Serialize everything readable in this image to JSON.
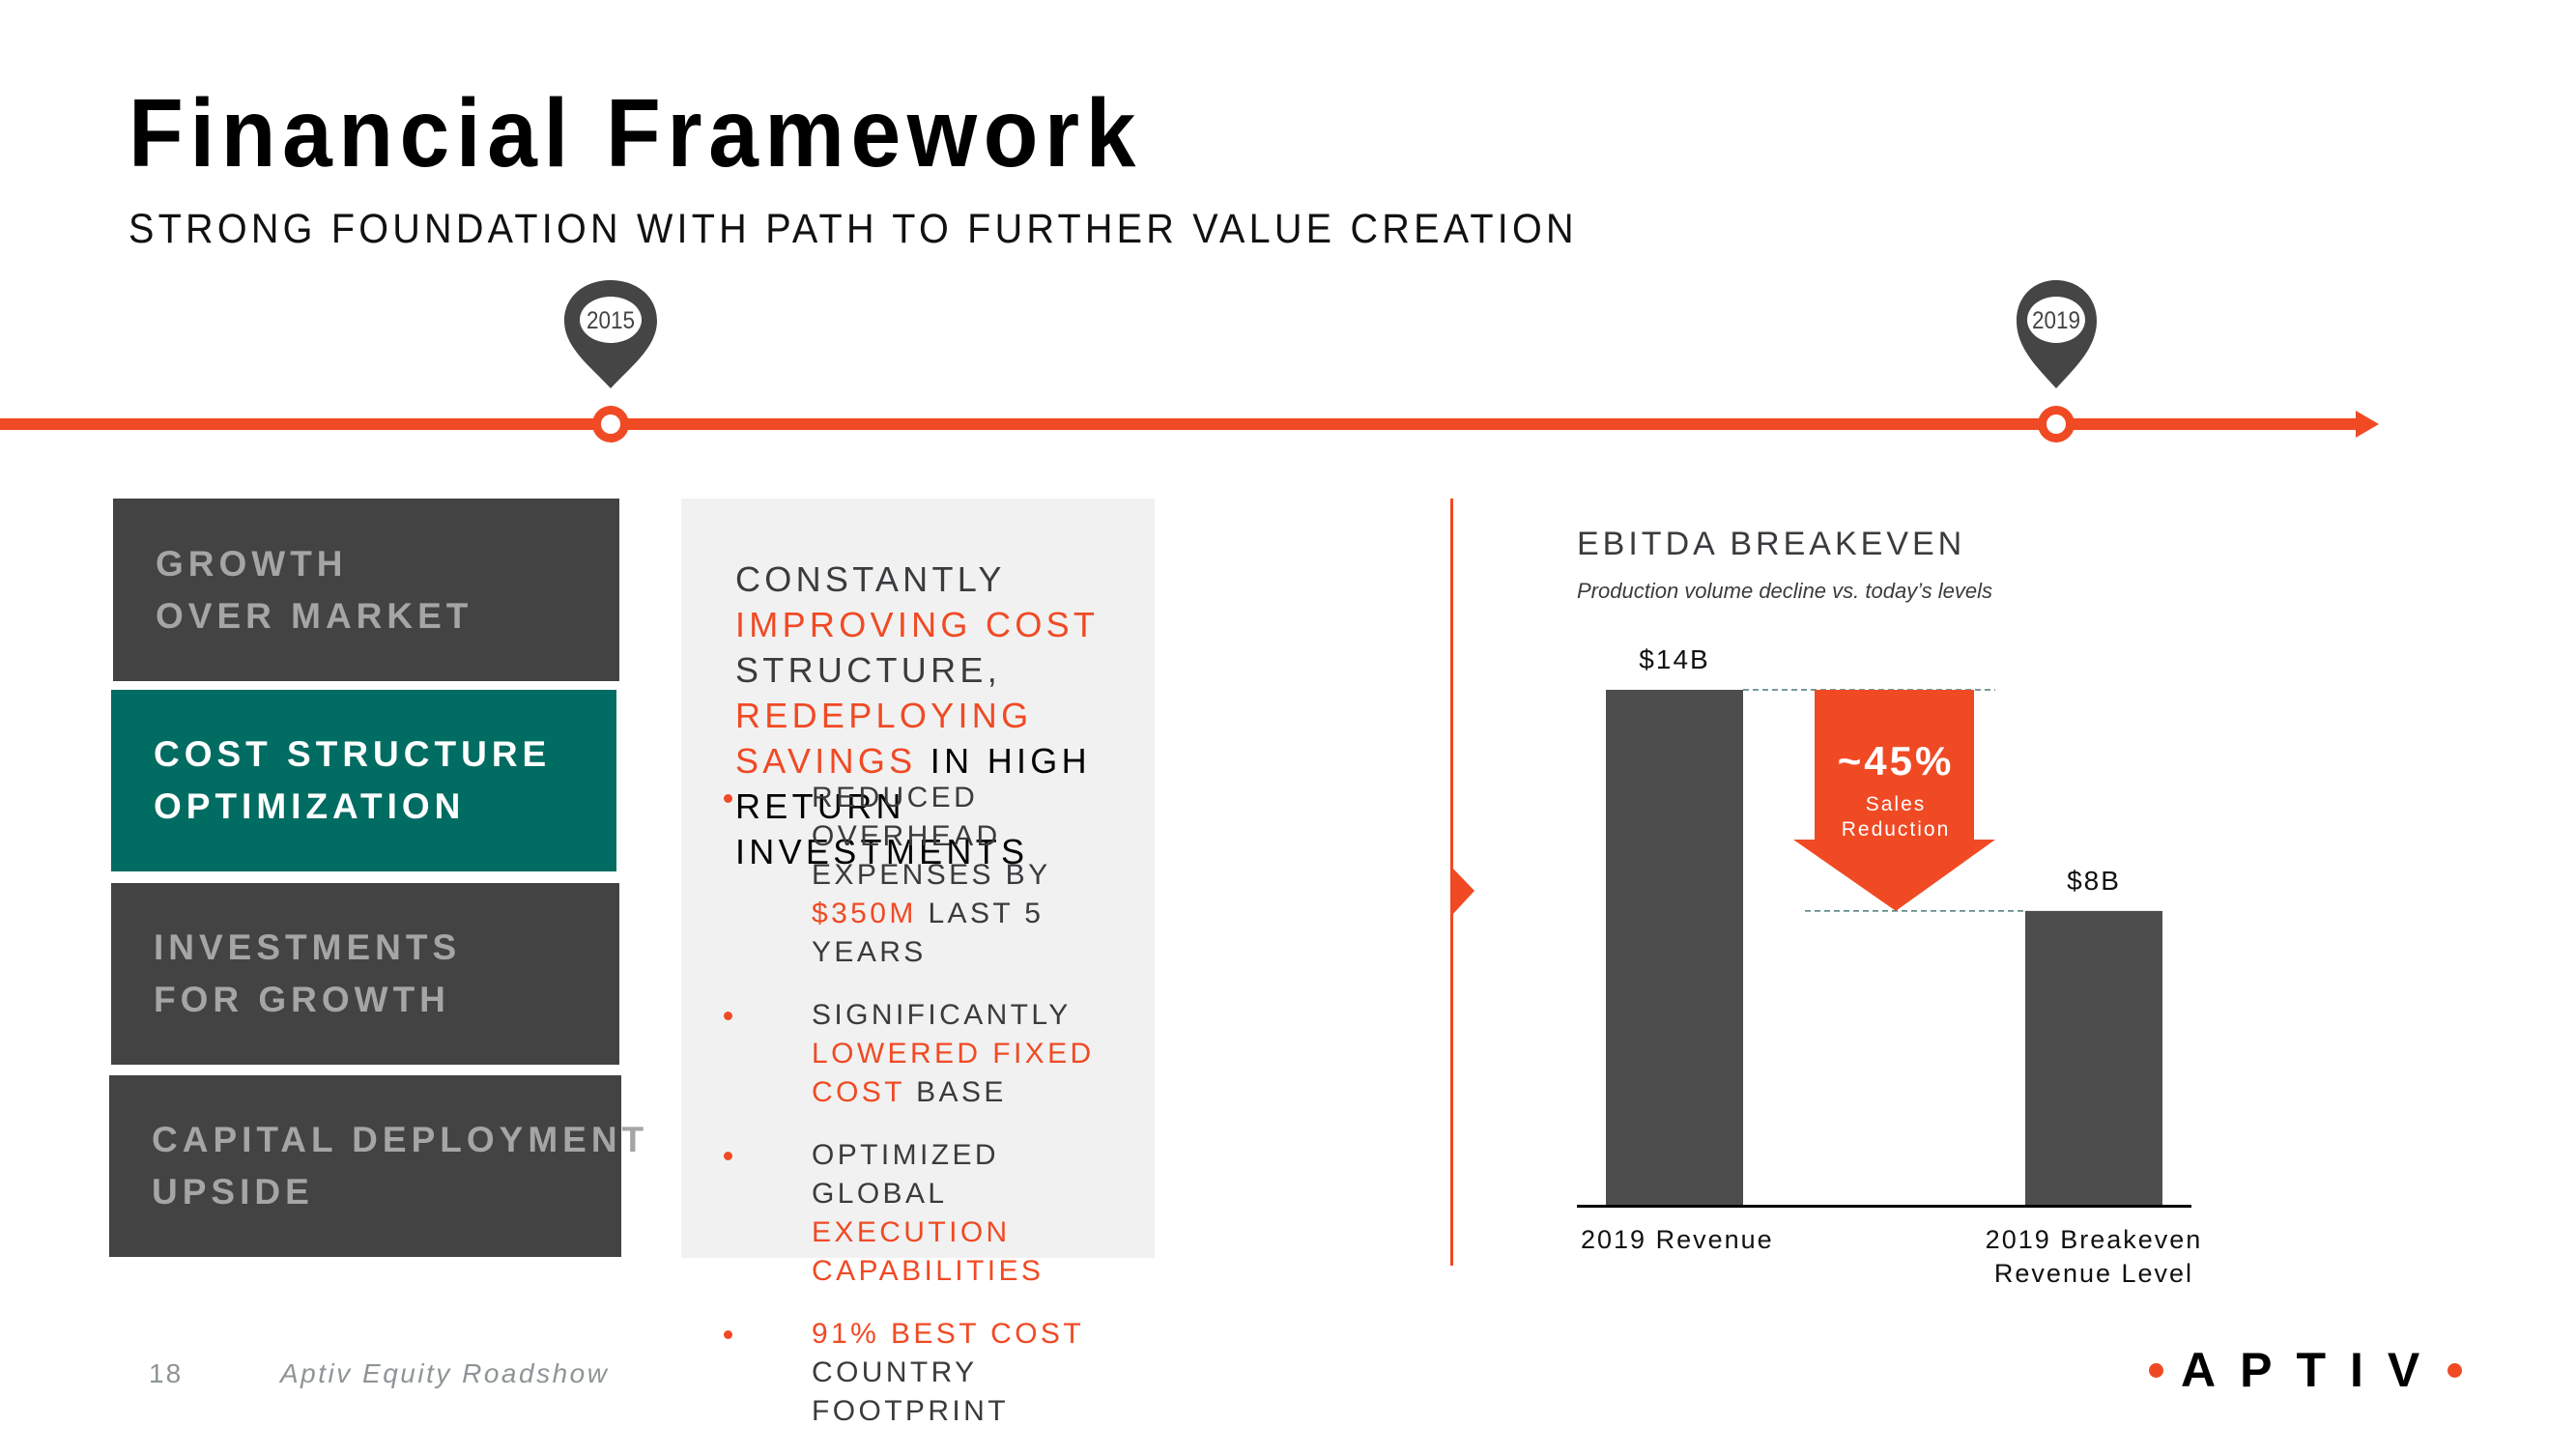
{
  "header": {
    "title": "Financial Framework",
    "subtitle": "STRONG FOUNDATION WITH PATH TO FURTHER VALUE CREATION"
  },
  "timeline": {
    "markers": [
      {
        "label": "2015"
      },
      {
        "label": "2019"
      }
    ]
  },
  "pillars": [
    {
      "lines": [
        "GROWTH",
        "OVER MARKET"
      ],
      "active": false
    },
    {
      "lines": [
        "COST STRUCTURE",
        "OPTIMIZATION"
      ],
      "active": true
    },
    {
      "lines": [
        "INVESTMENTS",
        "FOR GROWTH"
      ],
      "active": false
    },
    {
      "lines": [
        "CAPITAL DEPLOYMENT",
        "UPSIDE"
      ],
      "active": false
    }
  ],
  "panel": {
    "heading": {
      "p1": "CONSTANTLY ",
      "p2": "IMPROVING COST",
      "p3": " STRUCTURE, ",
      "p4": "REDEPLOYING SAVINGS",
      "p5": " IN HIGH RETURN INVESTMENTS"
    },
    "bullets": [
      {
        "a": "REDUCED OVERHEAD EXPENSES BY ",
        "b": "$350M",
        "c": " LAST 5 YEARS"
      },
      {
        "a": "SIGNIFICANTLY ",
        "b": "LOWERED FIXED COST",
        "c": " BASE"
      },
      {
        "a": "OPTIMIZED GLOBAL ",
        "b": "EXECUTION CAPABILITIES",
        "c": ""
      },
      {
        "a": "",
        "b": "91% BEST COST",
        "c": " COUNTRY FOOTPRINT"
      }
    ]
  },
  "chart_data": {
    "type": "bar",
    "title": "EBITDA BREAKEVEN",
    "subtitle": "Production volume decline vs. today’s levels",
    "categories": [
      "2019 Revenue",
      "2019 Breakeven Revenue Level"
    ],
    "category_lines": [
      [
        "2019 Revenue"
      ],
      [
        "2019 Breakeven",
        "Revenue Level"
      ]
    ],
    "values": [
      14,
      8
    ],
    "value_labels": [
      "$14B",
      "$8B"
    ],
    "unit": "$B",
    "ylim": [
      0,
      14
    ],
    "grid": false,
    "annotation": {
      "value": "~45%",
      "line1": "Sales",
      "line2": "Reduction",
      "type": "down-arrow"
    }
  },
  "colors": {
    "accent": "#f04a24",
    "teal": "#006c62",
    "dark_gray": "#434343",
    "bar_gray": "#4d4d4d",
    "panel_bg": "#f1f1f1"
  },
  "footer": {
    "page_number": "18",
    "text": "Aptiv Equity Roadshow",
    "logo": "APTIV"
  }
}
